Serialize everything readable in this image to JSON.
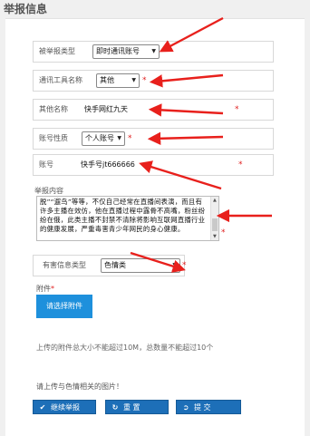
{
  "page_title": "举报信息",
  "fields": {
    "report_type": {
      "label": "被举报类型",
      "value": "即时通讯账号"
    },
    "tool_name": {
      "label": "通讯工具名称",
      "value": "其他"
    },
    "other_name": {
      "label": "其他名称",
      "value": "快手网红九天"
    },
    "account_nature": {
      "label": "账号性质",
      "value": "个人账号"
    },
    "account": {
      "label": "账号",
      "value": "快手号jt666666"
    }
  },
  "required_mark": "*",
  "report_content": {
    "label": "举报内容",
    "text": "脱”“遛鸟”等等，不仅自己经常在直播间表演，而且有许多主播在效仿，他在直播过程中露骨不高嘴，粉丝纷纷在俄，此类主播不封禁不清除将影响互联网直播行业的健康发展，严重毒害青少年网民的身心健康。"
  },
  "harmful_type": {
    "label": "有害信息类型",
    "value": "色情类"
  },
  "attachment": {
    "label": "附件",
    "button_label": "请选择附件"
  },
  "upload_note": "上传的附件总大小不能超过10M，总数量不能超过10个",
  "upload_hint": "请上传与色情相关的图片！",
  "buttons": {
    "continue": {
      "label": "继续举报",
      "icon": "check-icon"
    },
    "reset": {
      "label": "重 置",
      "icon": "refresh-icon"
    },
    "submit": {
      "label": "提 交",
      "icon": "submit-icon"
    }
  },
  "annotation_color": "#e8201c"
}
